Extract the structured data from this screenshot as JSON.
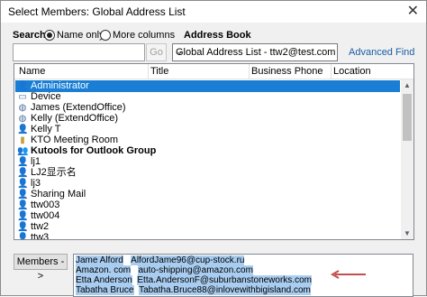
{
  "window": {
    "title": "Select Members: Global Address List",
    "close_glyph": "✕"
  },
  "search": {
    "label": "Search:",
    "option_name_only": "Name only",
    "option_more_columns": "More columns",
    "selected": "Name only",
    "input_value": "",
    "go_label": "Go"
  },
  "address_book": {
    "label": "Address Book",
    "selected": "Global Address List - ttw2@test.com",
    "advanced_find": "Advanced Find"
  },
  "columns": [
    "Name",
    "Title",
    "Business Phone",
    "Location"
  ],
  "entries": [
    {
      "name": "Administrator",
      "icon": "user-icon",
      "selected": true,
      "bold": false
    },
    {
      "name": "Device",
      "icon": "device-icon",
      "selected": false,
      "bold": false
    },
    {
      "name": "James (ExtendOffice)",
      "icon": "external-user-icon",
      "selected": false,
      "bold": false
    },
    {
      "name": "Kelly (ExtendOffice)",
      "icon": "external-user-icon",
      "selected": false,
      "bold": false
    },
    {
      "name": "Kelly T",
      "icon": "user-icon",
      "selected": false,
      "bold": false
    },
    {
      "name": "KTO Meeting Room",
      "icon": "room-icon",
      "selected": false,
      "bold": false
    },
    {
      "name": "Kutools for Outlook Group",
      "icon": "group-icon",
      "selected": false,
      "bold": true
    },
    {
      "name": "lj1",
      "icon": "user-icon",
      "selected": false,
      "bold": false
    },
    {
      "name": "LJ2显示名",
      "icon": "user-icon",
      "selected": false,
      "bold": false
    },
    {
      "name": "lj3",
      "icon": "user-icon",
      "selected": false,
      "bold": false
    },
    {
      "name": "Sharing Mail",
      "icon": "user-icon",
      "selected": false,
      "bold": false
    },
    {
      "name": "ttw003",
      "icon": "user-icon",
      "selected": false,
      "bold": false
    },
    {
      "name": "ttw004",
      "icon": "user-icon",
      "selected": false,
      "bold": false
    },
    {
      "name": "ttw2",
      "icon": "user-icon",
      "selected": false,
      "bold": false
    },
    {
      "name": "ttw3",
      "icon": "user-icon",
      "selected": false,
      "bold": false
    }
  ],
  "members_button": "Members ->",
  "members": [
    {
      "name": "Jame Alford",
      "email": "AlfordJame96@cup-stock.ru"
    },
    {
      "name": "Amazon. com",
      "email": "auto-shipping@amazon.com"
    },
    {
      "name": "Etta Anderson",
      "email": "Etta.AndersonF@suburbanstoneworks.com"
    },
    {
      "name": "Tabatha Bruce",
      "email": "Tabatha.Bruce88@inlovewithbigisland.com"
    }
  ],
  "colors": {
    "selection": "#1a7ed4",
    "highlight": "#a9cdf0",
    "arrow": "#c0504d",
    "link": "#1a5ea8"
  }
}
